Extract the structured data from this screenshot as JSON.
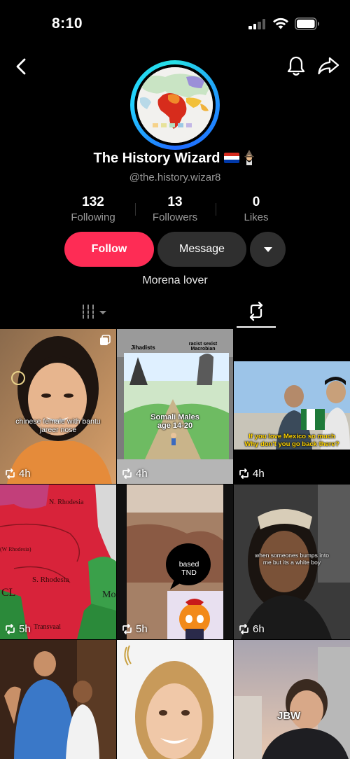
{
  "status_bar": {
    "time": "8:10"
  },
  "profile": {
    "name": "The History Wizard",
    "handle": "@the.history.wizar8",
    "bio": "Morena lover",
    "stats": [
      {
        "value": "132",
        "label": "Following"
      },
      {
        "value": "13",
        "label": "Followers"
      },
      {
        "value": "0",
        "label": "Likes"
      }
    ]
  },
  "buttons": {
    "follow": "Follow",
    "message": "Message"
  },
  "tabs": [
    {
      "name": "videos",
      "icon": "grid-icon",
      "active": false
    },
    {
      "name": "reposts",
      "icon": "repost-icon",
      "active": true
    }
  ],
  "grid": [
    {
      "caption": "chinese female with bantu jareer nose",
      "time": "4h",
      "multi": true
    },
    {
      "caption": "Somali Males age 14-20",
      "top_left": "Jihadists",
      "top_right": "racist sexist Macrobian",
      "time": "4h"
    },
    {
      "caption": "If you love Mexico so much Why don't you go back there?",
      "time": "4h"
    },
    {
      "caption": "N. Rhodesia",
      "caption2": "S. Rhodesia",
      "caption3": "Transvaal",
      "caption4": "Mo",
      "caption5": "CL",
      "caption6": "(W Rhodesia)",
      "time": "5h"
    },
    {
      "caption": "based TND",
      "time": "5h"
    },
    {
      "caption": "when someones bumps into me but its a white boy",
      "time": "6h"
    },
    {
      "caption": "",
      "time": ""
    },
    {
      "caption": "",
      "time": ""
    },
    {
      "caption": "JBW",
      "time": ""
    }
  ],
  "colors": {
    "accent": "#fe2c55",
    "secondary_button": "#2f2f2f",
    "muted_text": "#9a9a9a"
  }
}
